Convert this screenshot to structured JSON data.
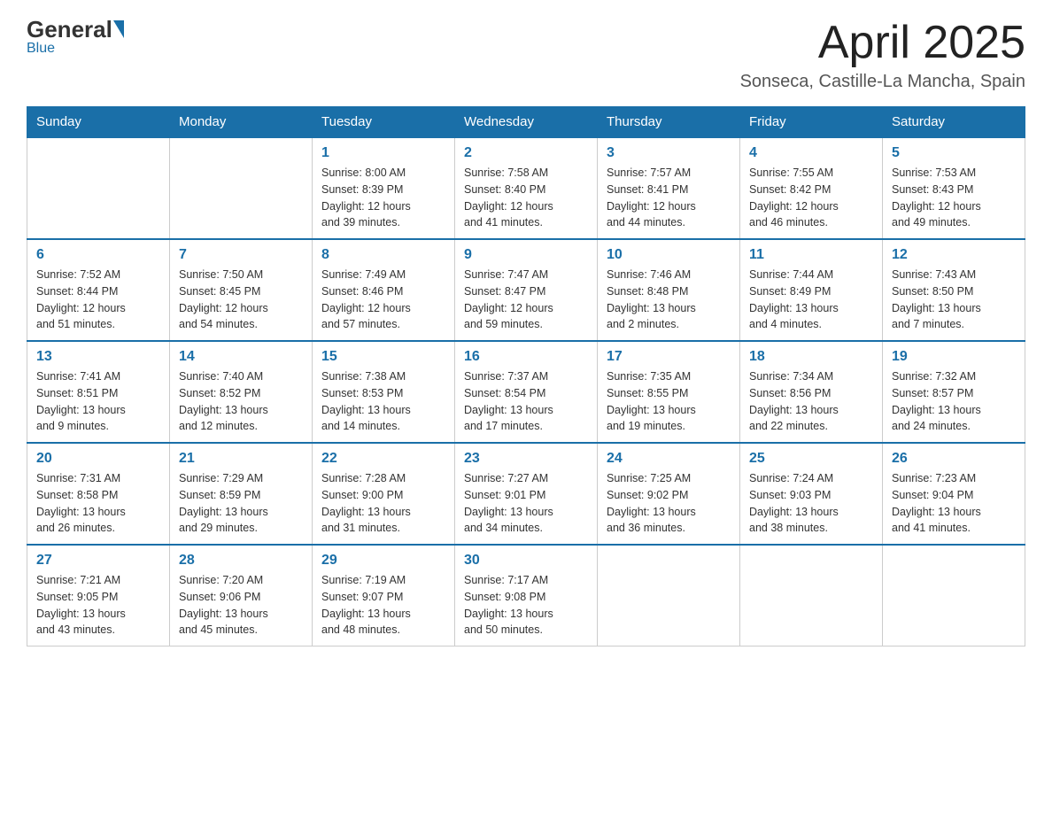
{
  "header": {
    "logo": {
      "general": "General",
      "blue": "Blue"
    },
    "title": "April 2025",
    "location": "Sonseca, Castille-La Mancha, Spain"
  },
  "days": [
    "Sunday",
    "Monday",
    "Tuesday",
    "Wednesday",
    "Thursday",
    "Friday",
    "Saturday"
  ],
  "weeks": [
    [
      {
        "day": "",
        "info": ""
      },
      {
        "day": "",
        "info": ""
      },
      {
        "day": "1",
        "info": "Sunrise: 8:00 AM\nSunset: 8:39 PM\nDaylight: 12 hours\nand 39 minutes."
      },
      {
        "day": "2",
        "info": "Sunrise: 7:58 AM\nSunset: 8:40 PM\nDaylight: 12 hours\nand 41 minutes."
      },
      {
        "day": "3",
        "info": "Sunrise: 7:57 AM\nSunset: 8:41 PM\nDaylight: 12 hours\nand 44 minutes."
      },
      {
        "day": "4",
        "info": "Sunrise: 7:55 AM\nSunset: 8:42 PM\nDaylight: 12 hours\nand 46 minutes."
      },
      {
        "day": "5",
        "info": "Sunrise: 7:53 AM\nSunset: 8:43 PM\nDaylight: 12 hours\nand 49 minutes."
      }
    ],
    [
      {
        "day": "6",
        "info": "Sunrise: 7:52 AM\nSunset: 8:44 PM\nDaylight: 12 hours\nand 51 minutes."
      },
      {
        "day": "7",
        "info": "Sunrise: 7:50 AM\nSunset: 8:45 PM\nDaylight: 12 hours\nand 54 minutes."
      },
      {
        "day": "8",
        "info": "Sunrise: 7:49 AM\nSunset: 8:46 PM\nDaylight: 12 hours\nand 57 minutes."
      },
      {
        "day": "9",
        "info": "Sunrise: 7:47 AM\nSunset: 8:47 PM\nDaylight: 12 hours\nand 59 minutes."
      },
      {
        "day": "10",
        "info": "Sunrise: 7:46 AM\nSunset: 8:48 PM\nDaylight: 13 hours\nand 2 minutes."
      },
      {
        "day": "11",
        "info": "Sunrise: 7:44 AM\nSunset: 8:49 PM\nDaylight: 13 hours\nand 4 minutes."
      },
      {
        "day": "12",
        "info": "Sunrise: 7:43 AM\nSunset: 8:50 PM\nDaylight: 13 hours\nand 7 minutes."
      }
    ],
    [
      {
        "day": "13",
        "info": "Sunrise: 7:41 AM\nSunset: 8:51 PM\nDaylight: 13 hours\nand 9 minutes."
      },
      {
        "day": "14",
        "info": "Sunrise: 7:40 AM\nSunset: 8:52 PM\nDaylight: 13 hours\nand 12 minutes."
      },
      {
        "day": "15",
        "info": "Sunrise: 7:38 AM\nSunset: 8:53 PM\nDaylight: 13 hours\nand 14 minutes."
      },
      {
        "day": "16",
        "info": "Sunrise: 7:37 AM\nSunset: 8:54 PM\nDaylight: 13 hours\nand 17 minutes."
      },
      {
        "day": "17",
        "info": "Sunrise: 7:35 AM\nSunset: 8:55 PM\nDaylight: 13 hours\nand 19 minutes."
      },
      {
        "day": "18",
        "info": "Sunrise: 7:34 AM\nSunset: 8:56 PM\nDaylight: 13 hours\nand 22 minutes."
      },
      {
        "day": "19",
        "info": "Sunrise: 7:32 AM\nSunset: 8:57 PM\nDaylight: 13 hours\nand 24 minutes."
      }
    ],
    [
      {
        "day": "20",
        "info": "Sunrise: 7:31 AM\nSunset: 8:58 PM\nDaylight: 13 hours\nand 26 minutes."
      },
      {
        "day": "21",
        "info": "Sunrise: 7:29 AM\nSunset: 8:59 PM\nDaylight: 13 hours\nand 29 minutes."
      },
      {
        "day": "22",
        "info": "Sunrise: 7:28 AM\nSunset: 9:00 PM\nDaylight: 13 hours\nand 31 minutes."
      },
      {
        "day": "23",
        "info": "Sunrise: 7:27 AM\nSunset: 9:01 PM\nDaylight: 13 hours\nand 34 minutes."
      },
      {
        "day": "24",
        "info": "Sunrise: 7:25 AM\nSunset: 9:02 PM\nDaylight: 13 hours\nand 36 minutes."
      },
      {
        "day": "25",
        "info": "Sunrise: 7:24 AM\nSunset: 9:03 PM\nDaylight: 13 hours\nand 38 minutes."
      },
      {
        "day": "26",
        "info": "Sunrise: 7:23 AM\nSunset: 9:04 PM\nDaylight: 13 hours\nand 41 minutes."
      }
    ],
    [
      {
        "day": "27",
        "info": "Sunrise: 7:21 AM\nSunset: 9:05 PM\nDaylight: 13 hours\nand 43 minutes."
      },
      {
        "day": "28",
        "info": "Sunrise: 7:20 AM\nSunset: 9:06 PM\nDaylight: 13 hours\nand 45 minutes."
      },
      {
        "day": "29",
        "info": "Sunrise: 7:19 AM\nSunset: 9:07 PM\nDaylight: 13 hours\nand 48 minutes."
      },
      {
        "day": "30",
        "info": "Sunrise: 7:17 AM\nSunset: 9:08 PM\nDaylight: 13 hours\nand 50 minutes."
      },
      {
        "day": "",
        "info": ""
      },
      {
        "day": "",
        "info": ""
      },
      {
        "day": "",
        "info": ""
      }
    ]
  ]
}
